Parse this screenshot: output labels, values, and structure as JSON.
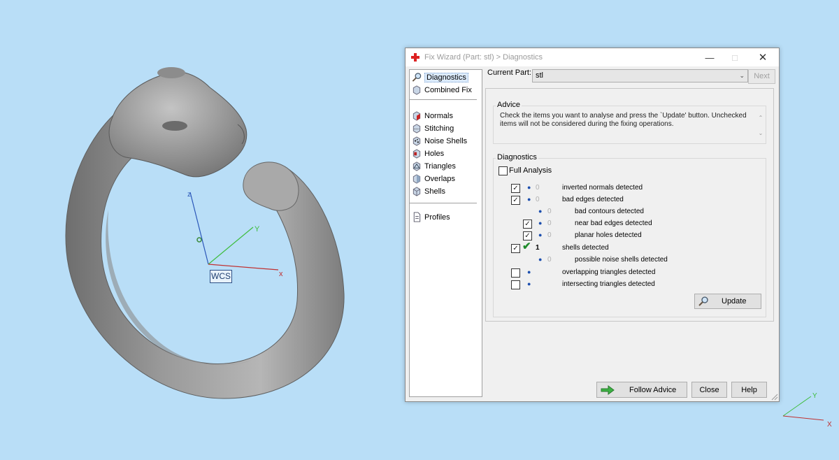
{
  "viewport": {
    "wcs_label": "WCS",
    "axis_labels": {
      "x": "x",
      "y": "Y",
      "z": "z"
    },
    "mini_axis_labels": {
      "x": "X",
      "y": "Y"
    },
    "background_color": "#b9def7"
  },
  "dialog": {
    "title": "Fix Wizard (Part: stl) > Diagnostics",
    "title_icon": "red-cross-icon",
    "nav": [
      {
        "label": "Diagnostics",
        "icon": "magnifier-icon",
        "selected": true
      },
      {
        "label": "Combined Fix",
        "icon": "cube-icon"
      },
      {
        "label": "Normals",
        "icon": "normals-cube-icon"
      },
      {
        "label": "Stitching",
        "icon": "stitching-cube-icon"
      },
      {
        "label": "Noise Shells",
        "icon": "noise-shells-icon"
      },
      {
        "label": "Holes",
        "icon": "holes-cube-icon"
      },
      {
        "label": "Triangles",
        "icon": "triangles-cube-icon"
      },
      {
        "label": "Overlaps",
        "icon": "overlaps-cube-icon"
      },
      {
        "label": "Shells",
        "icon": "shells-cube-icon"
      },
      {
        "label": "Profiles",
        "icon": "document-icon"
      }
    ],
    "current_part_label": "Current Part:",
    "current_part_value": "stl",
    "next_label": "Next",
    "advice": {
      "title": "Advice",
      "text": "Check the items you want to analyse and press the `Update' button. Unchecked items will not be considered during the fixing operations."
    },
    "diagnostics": {
      "title": "Diagnostics",
      "full_analysis_label": "Full Analysis",
      "items": [
        {
          "label": "inverted normals detected",
          "count": "0",
          "checked": true
        },
        {
          "label": "bad edges detected",
          "count": "0",
          "checked": true
        },
        {
          "label": "bad contours detected",
          "count": "0"
        },
        {
          "label": "near bad edges detected",
          "count": "0",
          "checked": true
        },
        {
          "label": "planar holes detected",
          "count": "0",
          "checked": true
        },
        {
          "label": "shells detected",
          "count": "1",
          "checked": true,
          "status": "ok"
        },
        {
          "label": "possible noise shells detected",
          "count": "0"
        },
        {
          "label": "overlapping triangles detected",
          "count": "",
          "checked": false
        },
        {
          "label": "intersecting triangles detected",
          "count": "",
          "checked": false
        }
      ],
      "update_label": "Update"
    },
    "buttons": {
      "follow_advice": "Follow Advice",
      "close": "Close",
      "help": "Help"
    }
  }
}
